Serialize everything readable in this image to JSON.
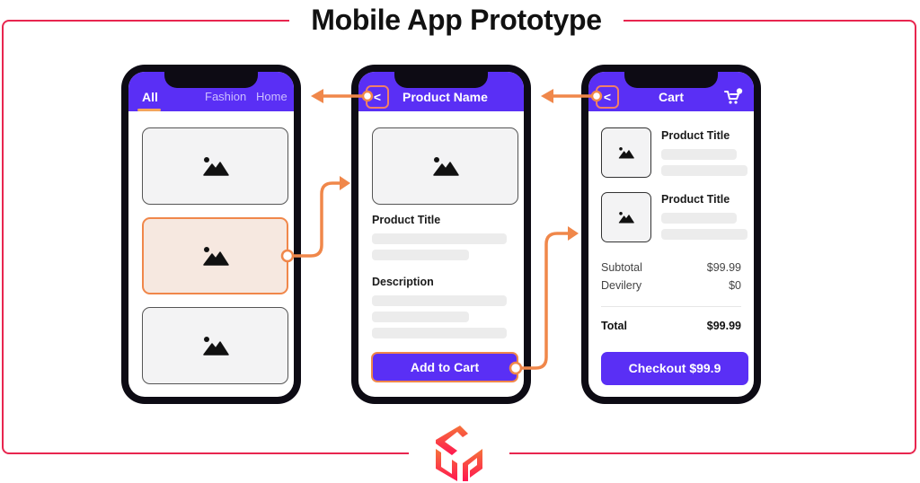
{
  "title": "Mobile App Prototype",
  "colors": {
    "frame": "#e8264f",
    "brand": "#5a2ff5",
    "connector": "#f0874a",
    "highlight_bg": "#f6e8e0"
  },
  "screens": {
    "home": {
      "tabs": [
        {
          "label": "All",
          "active": true
        },
        {
          "label": "Fashion",
          "active": false
        },
        {
          "label": "Home",
          "active": false
        }
      ],
      "cards": [
        {
          "icon": "image-icon",
          "selected": false
        },
        {
          "icon": "image-icon",
          "selected": true
        },
        {
          "icon": "image-icon",
          "selected": false
        }
      ]
    },
    "product": {
      "back_label": "<",
      "header_title": "Product Name",
      "image_icon": "image-icon",
      "product_title": "Product Title",
      "description_label": "Description",
      "add_to_cart_label": "Add to Cart"
    },
    "cart": {
      "back_label": "<",
      "header_title": "Cart",
      "cart_icon": "cart-icon",
      "items": [
        {
          "title": "Product Title",
          "icon": "image-icon"
        },
        {
          "title": "Product Title",
          "icon": "image-icon"
        }
      ],
      "summary": [
        {
          "label": "Subtotal",
          "value": "$99.99"
        },
        {
          "label": "Devilery",
          "value": "$0"
        }
      ],
      "total": {
        "label": "Total",
        "value": "$99.99"
      },
      "checkout_label": "Checkout $99.9"
    }
  },
  "flows": [
    {
      "from": "home-card-2",
      "to": "product-screen"
    },
    {
      "from": "add-to-cart-button",
      "to": "cart-screen"
    },
    {
      "from": "product-back-button",
      "to": "home-screen"
    },
    {
      "from": "cart-back-button",
      "to": "product-screen"
    }
  ]
}
